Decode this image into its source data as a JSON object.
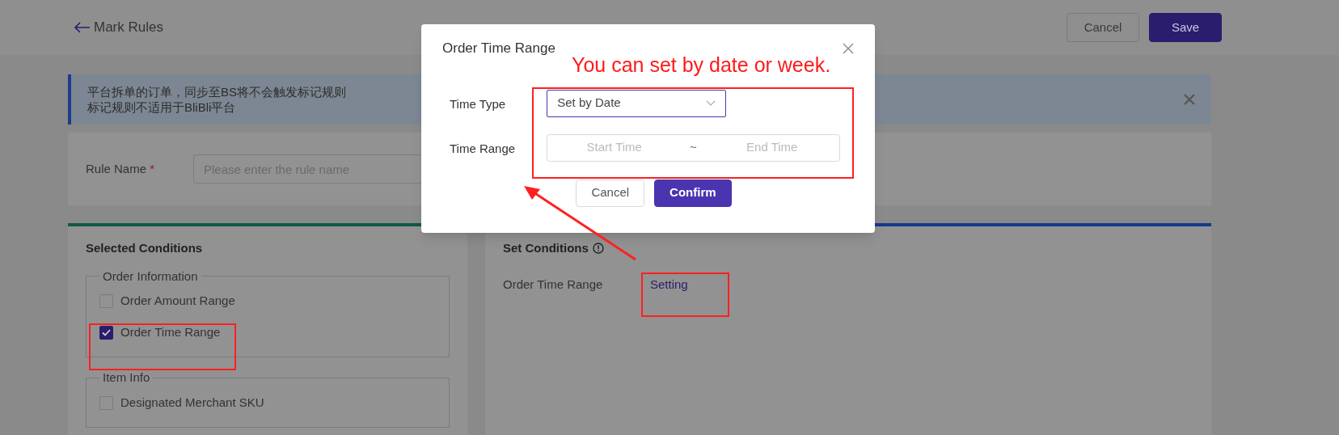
{
  "header": {
    "title": "Mark Rules",
    "buttons": [
      {
        "label": "Cancel",
        "kind": "secondary"
      },
      {
        "label": "Save",
        "kind": "primary"
      }
    ]
  },
  "alert": {
    "lines": [
      "平台拆单的订单，同步至BS将不会触发标记规则",
      "标记规则不适用于BliBli平台"
    ]
  },
  "rule_name": {
    "label": "Rule Name",
    "required_mark": "*",
    "placeholder": "Please enter the rule name"
  },
  "selected_conditions": {
    "title": "Selected Conditions",
    "groups": [
      {
        "title": "Order Information",
        "items": [
          {
            "label": "Order Amount Range",
            "checked": false
          },
          {
            "label": "Order Time Range",
            "checked": true
          }
        ]
      },
      {
        "title": "Item Info",
        "items": [
          {
            "label": "Designated Merchant SKU",
            "checked": false
          }
        ]
      }
    ]
  },
  "set_conditions": {
    "title": "Set Conditions",
    "rows": [
      {
        "label": "Order Time Range",
        "link": "Setting"
      }
    ]
  },
  "modal": {
    "title": "Order Time Range",
    "fields": [
      {
        "kind": "select",
        "label": "Time Type",
        "value": "Set by Date"
      },
      {
        "kind": "range",
        "label": "Time Range",
        "start_placeholder": "Start Time",
        "separator": "~",
        "end_placeholder": "End Time"
      }
    ],
    "buttons": [
      {
        "label": "Cancel",
        "kind": "secondary"
      },
      {
        "label": "Confirm",
        "kind": "primary"
      }
    ]
  },
  "annotation": {
    "note": "You can set by date or week."
  }
}
